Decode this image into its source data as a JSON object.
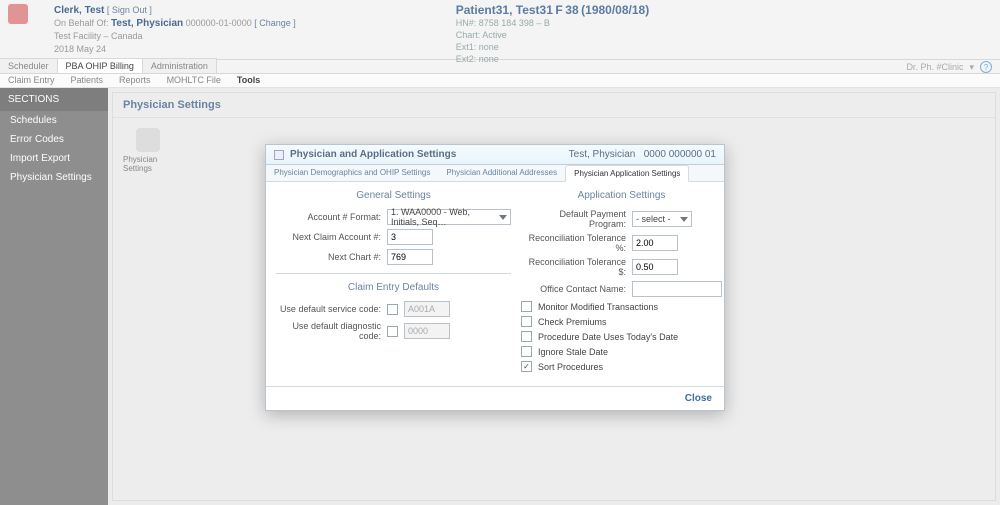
{
  "header": {
    "clerk_label": "Clerk, Test",
    "signout": "[ Sign Out ]",
    "on_behalf_label": "On Behalf Of:",
    "on_behalf_name": "Test, Physician",
    "on_behalf_id": "000000-01-0000",
    "change": "[ Change ]",
    "facility": "Test Facility – Canada",
    "date": "2018 May 24"
  },
  "patient": {
    "name": "Patient31, Test31",
    "sex": "F",
    "age": "38",
    "dob": "(1980/08/18)",
    "hn_label": "HN#:",
    "hn": "8758 184 398 – B",
    "chart_label": "Chart:",
    "chart": "Active",
    "ext1_label": "Ext1:",
    "ext1": "none",
    "ext2_label": "Ext2:",
    "ext2": "none"
  },
  "outer_tabs": [
    "Scheduler",
    "PBA OHIP Billing",
    "Administration"
  ],
  "outer_tab_active": "PBA OHIP Billing",
  "user_label": "Dr. Ph. #Clinic",
  "inner_tabs": [
    "Claim Entry",
    "Patients",
    "Reports",
    "MOHLTC File",
    "Tools"
  ],
  "inner_tab_active": "Tools",
  "sidebar": {
    "title": "SECTIONS",
    "items": [
      "Schedules",
      "Error Codes",
      "Import Export",
      "Physician Settings"
    ]
  },
  "main": {
    "heading": "Physician Settings",
    "card_label": "Physician Settings"
  },
  "modal": {
    "title": "Physician and Application Settings",
    "phys_name": "Test, Physician",
    "phys_codes": "0000   000000   01",
    "tabs": [
      "Physician Demographics and OHIP Settings",
      "Physician Additional Addresses",
      "Physician Application Settings"
    ],
    "tab_active": "Physician Application Settings",
    "general": {
      "heading": "General Settings",
      "account_format_label": "Account # Format:",
      "account_format_value": "1. WAA0000 - Web, Initials, Seq…",
      "next_claim_label": "Next Claim Account #:",
      "next_claim_value": "3",
      "next_chart_label": "Next Chart #:",
      "next_chart_value": "769"
    },
    "claim_defaults": {
      "heading": "Claim Entry Defaults",
      "service_label": "Use default service code:",
      "service_checked": false,
      "service_value": "A001A",
      "diag_label": "Use default diagnostic code:",
      "diag_checked": false,
      "diag_value": "0000"
    },
    "app": {
      "heading": "Application Settings",
      "dpp_label": "Default Payment Program:",
      "dpp_value": "- select -",
      "rtp_label": "Reconciliation Tolerance %:",
      "rtp_value": "2.00",
      "rtd_label": "Reconciliation Tolerance $:",
      "rtd_value": "0.50",
      "contact_label": "Office Contact Name:",
      "contact_value": "",
      "flags": [
        {
          "label": "Monitor Modified Transactions",
          "checked": false
        },
        {
          "label": "Check Premiums",
          "checked": false
        },
        {
          "label": "Procedure Date Uses Today's Date",
          "checked": false
        },
        {
          "label": "Ignore Stale Date",
          "checked": false
        },
        {
          "label": "Sort Procedures",
          "checked": true
        }
      ]
    },
    "close": "Close"
  }
}
